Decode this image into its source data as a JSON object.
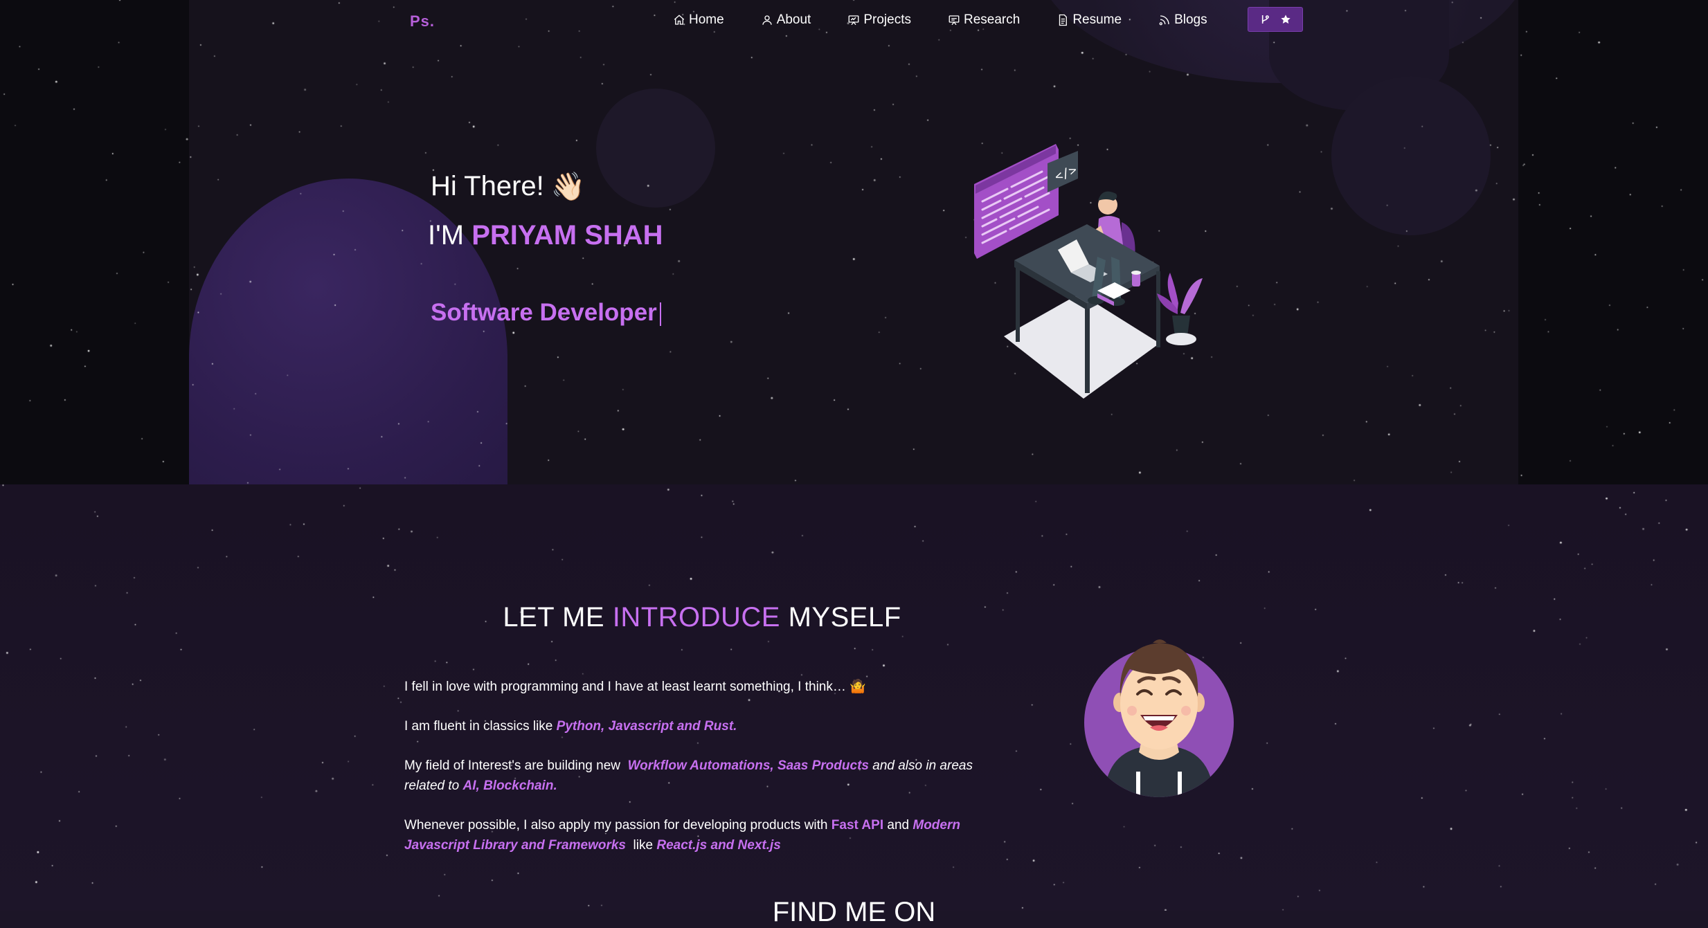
{
  "nav": {
    "logo": "Ps.",
    "items": [
      {
        "label": "Home",
        "icon": "home-icon"
      },
      {
        "label": "About",
        "icon": "user-icon"
      },
      {
        "label": "Projects",
        "icon": "projects-icon"
      },
      {
        "label": "Research",
        "icon": "research-icon"
      },
      {
        "label": "Resume",
        "icon": "document-icon"
      },
      {
        "label": "Blogs",
        "icon": "rss-icon"
      }
    ],
    "github_button": {
      "icons": [
        "git-branch-icon",
        "star-icon"
      ]
    }
  },
  "hero": {
    "greeting": "Hi There!",
    "wave_emoji": "👋🏻",
    "iam_prefix": "I'M",
    "name": "PRIYAM SHAH",
    "role": "Software Developer"
  },
  "intro": {
    "title_start": "LET ME",
    "title_highlight": "INTRODUCE",
    "title_end": "MYSELF",
    "p1": "I fell in love with programming and I have at least learnt something, I think… 🤷",
    "p2_prefix": "I am fluent in classics like",
    "p2_langs": "Python, Javascript and Rust.",
    "p3_prefix": "My field of Interest's are building new",
    "p3_highlight": "Workflow Automations, Saas Products",
    "p3_mid": "and also in areas related to",
    "p3_areas": "AI, Blockchain.",
    "p4_prefix": "Whenever possible, I also apply my passion for developing products with",
    "p4_fastapi": "Fast API",
    "p4_and": "and",
    "p4_modern": "Modern Javascript Library and Frameworks",
    "p4_like": "like",
    "p4_react": "React.js and Next.js"
  },
  "find": {
    "title": "FIND ME ON"
  },
  "colors": {
    "accent": "#c770f0",
    "button": "#5a2a85",
    "bg": "#1c1527"
  }
}
